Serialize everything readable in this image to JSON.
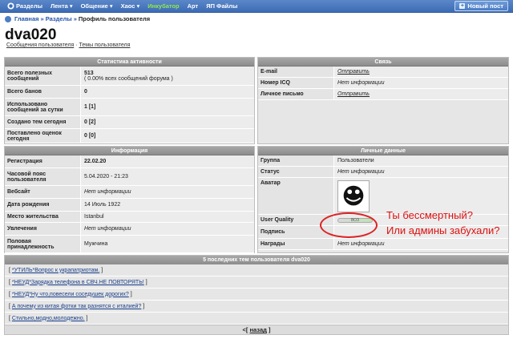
{
  "nav": {
    "items": [
      {
        "label": "Разделы",
        "arrow": false,
        "color": "#ffffff"
      },
      {
        "label": "Лента",
        "arrow": true,
        "color": "#ffffff"
      },
      {
        "label": "Общение",
        "arrow": true,
        "color": "#ffffff"
      },
      {
        "label": "Хаос",
        "arrow": true,
        "color": "#ffffff"
      },
      {
        "label": "Инкубатор",
        "arrow": false,
        "color": "#8fe84f"
      },
      {
        "label": "Арт",
        "arrow": false,
        "color": "#ffffff"
      },
      {
        "label": "ЯП Файлы",
        "arrow": false,
        "color": "#ffffff"
      }
    ],
    "new_post": "Новый пост"
  },
  "breadcrumb": {
    "home": "Главная",
    "sections": "Разделы",
    "current": "Профиль пользователя",
    "separator": "»"
  },
  "user": {
    "name": "dva020",
    "link_posts": "Сообщения пользователя",
    "link_sep": "·",
    "link_topics": "Темы пользователя"
  },
  "stats": {
    "title": "Статистика активности",
    "rows": [
      {
        "key": "Всего полезных сообщений",
        "value": "513",
        "sub": "( 0.00% всех сообщений форума )"
      },
      {
        "key": "Всего банов",
        "value": "0"
      },
      {
        "key": "Использовано сообщений за сутки",
        "value": "1 [1]"
      },
      {
        "key": "Создано тем сегодня",
        "value": "0 [2]"
      },
      {
        "key": "Поставлено оценок сегодня",
        "value": "0 [0]"
      }
    ]
  },
  "contact": {
    "title": "Связь",
    "rows": [
      {
        "key": "E-mail",
        "value": "Отправить",
        "link": true
      },
      {
        "key": "Номер ICQ",
        "value": "Нет информации",
        "link": false
      },
      {
        "key": "Личное письмо",
        "value": "Отправить",
        "link": true
      }
    ]
  },
  "info": {
    "title": "Информация",
    "rows": [
      {
        "key": "Регистрация",
        "value": "22.02.20",
        "bold": true
      },
      {
        "key": "Часовой пояс пользователя",
        "value": "5.04.2020 - 21:23",
        "bold": false
      },
      {
        "key": "Вебсайт",
        "value": "Нет информации",
        "italic": true
      },
      {
        "key": "Дата рождения",
        "value": "14 Июль 1922"
      },
      {
        "key": "Место жительства",
        "value": "Istanbul"
      },
      {
        "key": "Увлечения",
        "value": "Нет информации",
        "italic": true
      },
      {
        "key": "Половая принадлежность",
        "value": "Мужчина"
      }
    ]
  },
  "personal": {
    "title": "Личные данные",
    "group_key": "Группа",
    "group_value": "Пользователи",
    "status_key": "Статус",
    "status_value": "Нет информации",
    "avatar_key": "Аватар",
    "uq_key": "User Quality",
    "uq_value": "ВОЗ",
    "sig_key": "Подпись",
    "awards_key": "Награды",
    "awards_value": "Нет информации"
  },
  "annotation": {
    "line1": "Ты бессмертный?",
    "line2": "Или админы забухали?",
    "color": "#dd1111"
  },
  "topics": {
    "title": "5 последних тем пользователя dva020",
    "items": [
      "*УТИЛЬ*Вопрос к украпатриотам.",
      "*НЕУД*Зарядка телефона в СВЧ.НЕ ПОВТОРЯТЬ!",
      "*НЕУД*Ну что,повесели соседушек дорогих?",
      "А почему из китая фотки так разнятся с италией?",
      "Стильно,модно,молодежно."
    ]
  },
  "back": {
    "label": "назад",
    "prefix": "<[",
    "suffix": "]"
  }
}
